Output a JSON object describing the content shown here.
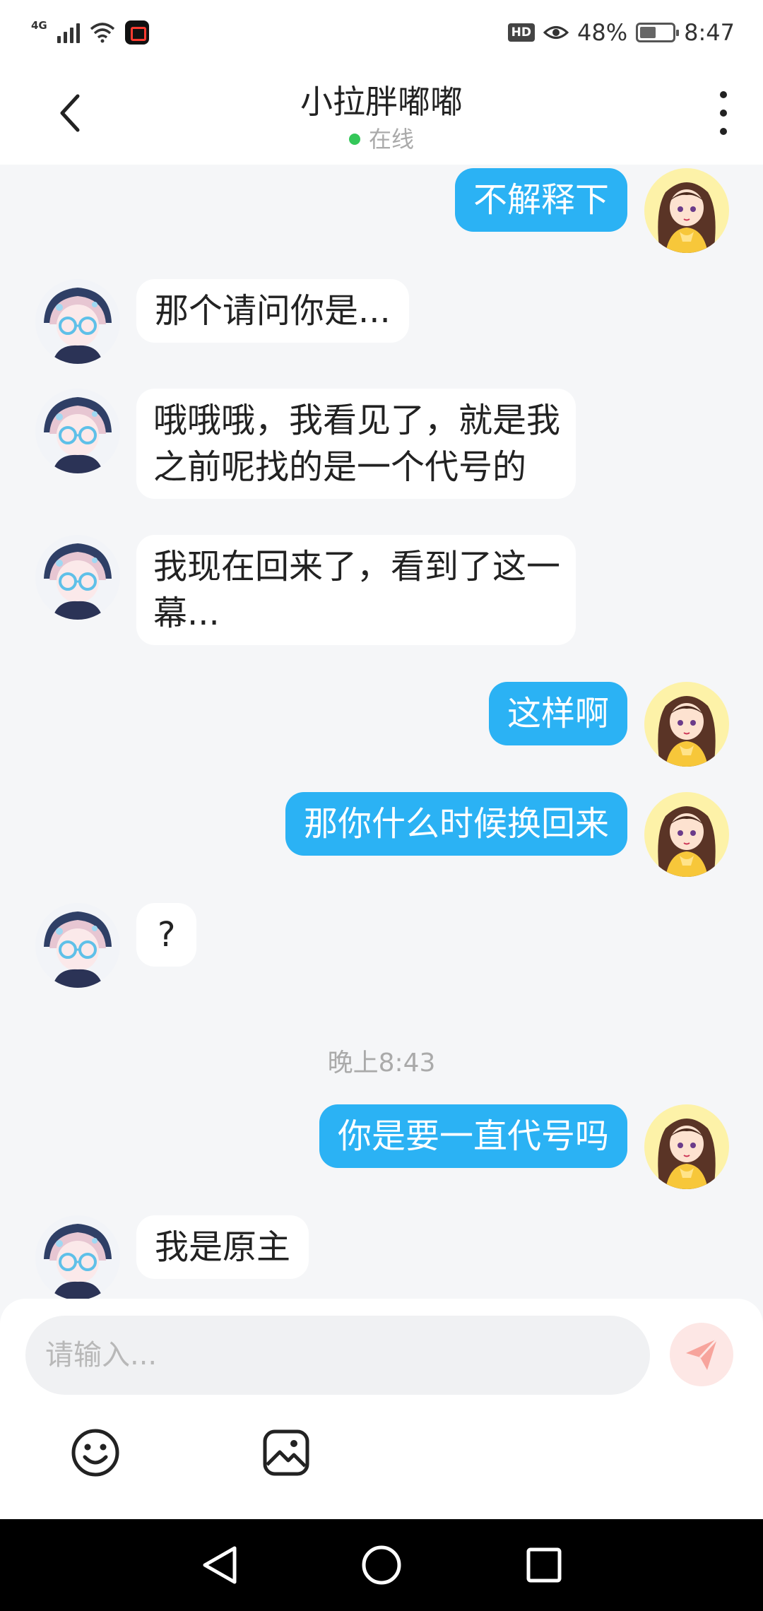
{
  "status_bar": {
    "network": "4G",
    "hd_badge": "HD",
    "battery": "48%",
    "time": "8:47"
  },
  "header": {
    "title": "小拉胖嘟嘟",
    "status": "在线",
    "icons": {
      "back": "chevron-left-icon",
      "more": "more-vertical-icon"
    },
    "online_color": "#34c759"
  },
  "messages": [
    {
      "side": "right",
      "text": "不解释下"
    },
    {
      "side": "left",
      "text": "那个请问你是..."
    },
    {
      "side": "left",
      "text_lines": [
        "哦哦哦，我看见了，就是我",
        "之前呢找的是一个代号的"
      ]
    },
    {
      "side": "left",
      "text_lines": [
        "我现在回来了，看到了这一",
        "幕..."
      ]
    },
    {
      "side": "right",
      "text": "这样啊"
    },
    {
      "side": "right",
      "text": "那你什么时候换回来"
    },
    {
      "side": "left",
      "text": "?"
    },
    {
      "type": "timestamp",
      "text": "晚上8:43"
    },
    {
      "side": "right",
      "text": "你是要一直代号吗"
    },
    {
      "side": "left",
      "text": "我是原主"
    }
  ],
  "input": {
    "placeholder": "请输入...",
    "value": "",
    "send_icon": "send-icon",
    "tools": [
      "emoji-icon",
      "image-icon"
    ]
  },
  "nav": {
    "buttons": [
      "back-triangle-icon",
      "home-circle-icon",
      "recents-square-icon"
    ]
  },
  "colors": {
    "sent_bubble": "#2bb2f4",
    "received_bubble": "#ffffff",
    "background": "#f5f6f8"
  }
}
